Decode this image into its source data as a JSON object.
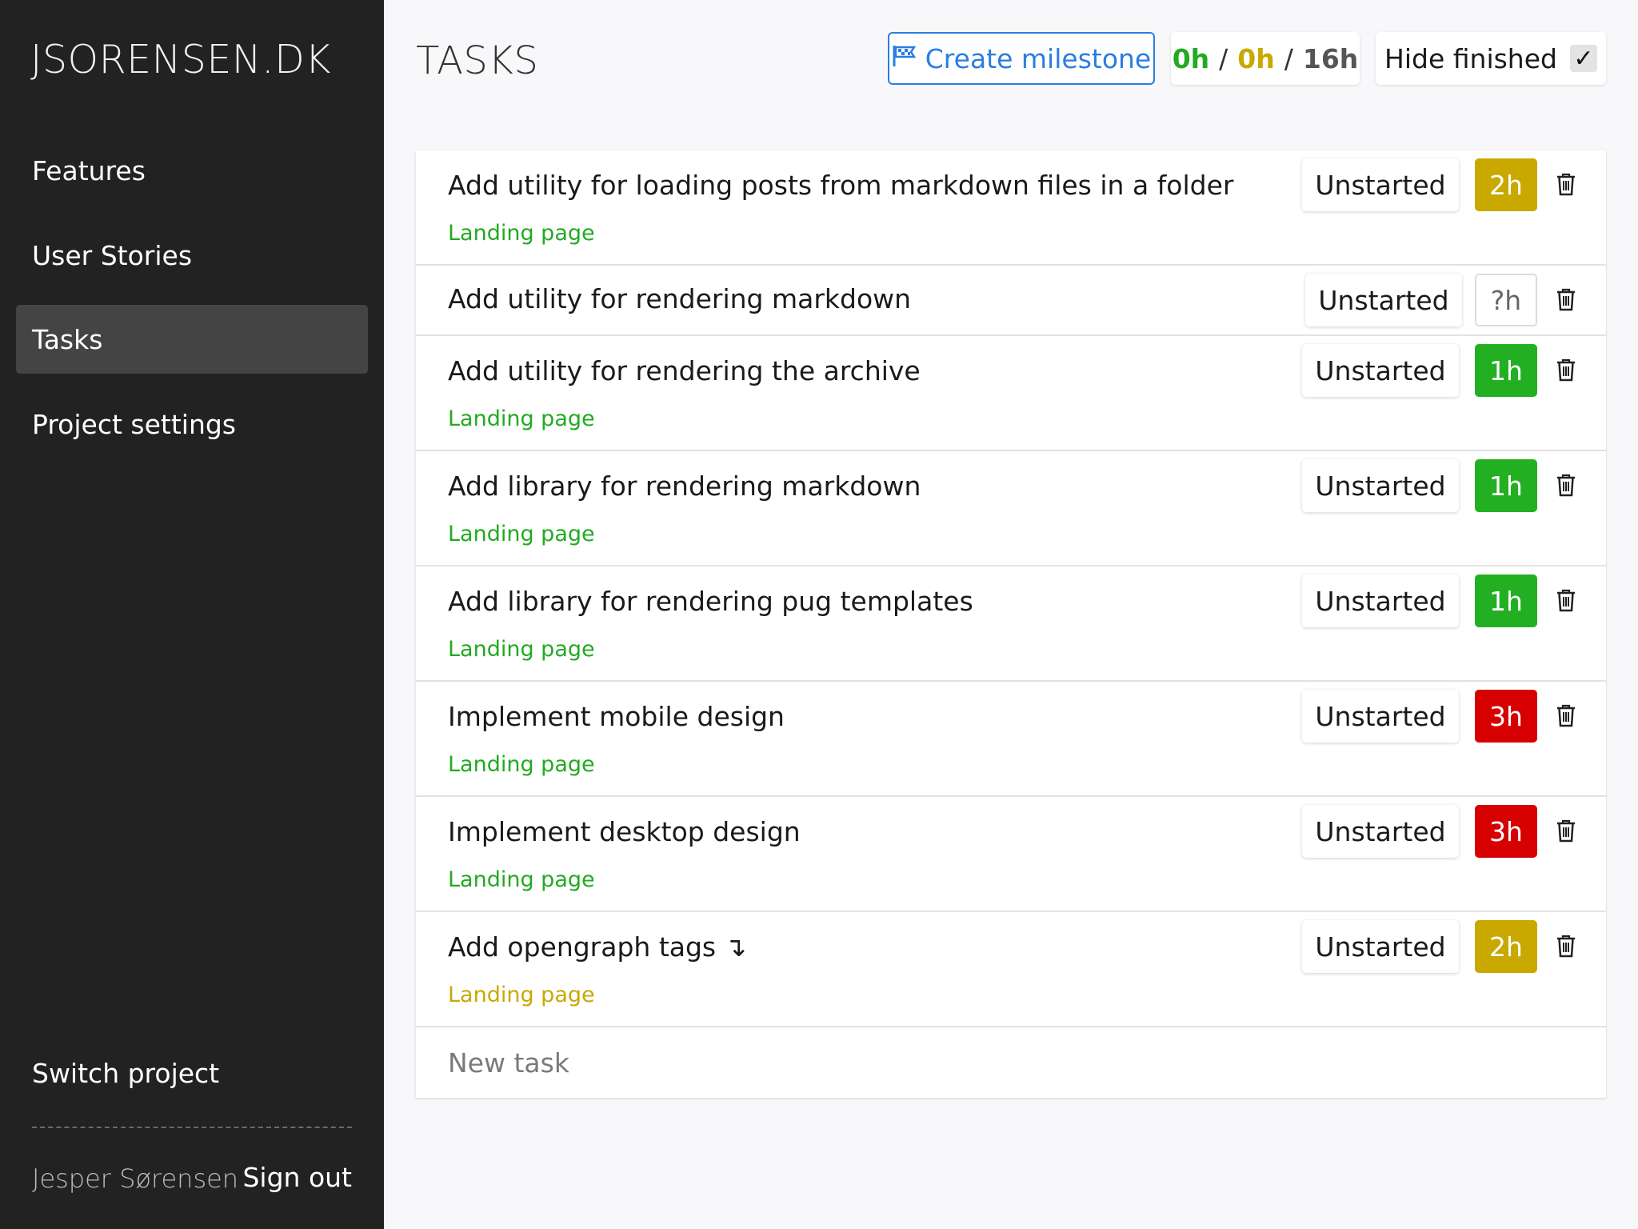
{
  "sidebar": {
    "brand": "JSORENSEN.DK",
    "nav": [
      {
        "label": "Features"
      },
      {
        "label": "User Stories"
      },
      {
        "label": "Tasks",
        "active": true
      },
      {
        "label": "Project settings"
      }
    ],
    "switch_project": "Switch project",
    "user_name": "Jesper Sørensen",
    "sign_out": "Sign out"
  },
  "header": {
    "title": "TASKS",
    "create_milestone": "Create milestone",
    "hours": {
      "done": "0h",
      "in_progress": "0h",
      "total": "16h",
      "separator": "/"
    },
    "hide_finished": "Hide finished",
    "hide_finished_checked": "✓"
  },
  "colors": {
    "green": "#22aa22",
    "yellow": "#c9a800",
    "red": "#d60000",
    "blue": "#2a7de1"
  },
  "tasks": [
    {
      "title": "Add utility for loading posts from markdown files in a folder",
      "feature": "Landing page",
      "feature_color": "#22aa22",
      "status": "Unstarted",
      "hours": "2h",
      "hours_color": "#c9a800"
    },
    {
      "title": "Add utility for rendering markdown",
      "feature": "",
      "status": "Unstarted",
      "hours": "?h",
      "hours_color": ""
    },
    {
      "title": "Add utility for rendering the archive",
      "feature": "Landing page",
      "feature_color": "#22aa22",
      "status": "Unstarted",
      "hours": "1h",
      "hours_color": "#22b022"
    },
    {
      "title": "Add library for rendering markdown",
      "feature": "Landing page",
      "feature_color": "#22aa22",
      "status": "Unstarted",
      "hours": "1h",
      "hours_color": "#22b022"
    },
    {
      "title": "Add library for rendering pug templates",
      "feature": "Landing page",
      "feature_color": "#22aa22",
      "status": "Unstarted",
      "hours": "1h",
      "hours_color": "#22b022"
    },
    {
      "title": "Implement mobile design",
      "feature": "Landing page",
      "feature_color": "#22aa22",
      "status": "Unstarted",
      "hours": "3h",
      "hours_color": "#d60000"
    },
    {
      "title": "Implement desktop design",
      "feature": "Landing page",
      "feature_color": "#22aa22",
      "status": "Unstarted",
      "hours": "3h",
      "hours_color": "#d60000"
    },
    {
      "title": "Add opengraph tags ↴",
      "feature": "Landing page",
      "feature_color": "#c9a800",
      "status": "Unstarted",
      "hours": "2h",
      "hours_color": "#c9a800"
    }
  ],
  "new_task": {
    "placeholder": "New task",
    "value": ""
  }
}
